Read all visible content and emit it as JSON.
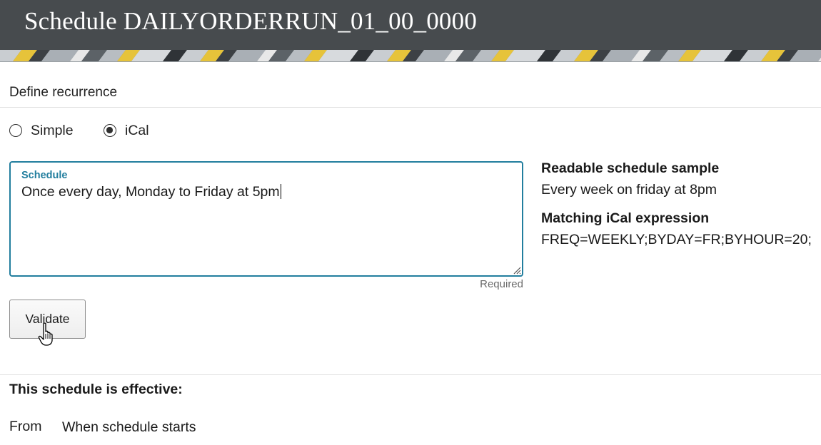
{
  "header": {
    "title": "Schedule DAILYORDERRUN_01_00_0000"
  },
  "recurrence": {
    "section_title": "Define recurrence",
    "options": [
      {
        "label": "Simple",
        "selected": false
      },
      {
        "label": "iCal",
        "selected": true
      }
    ]
  },
  "schedule_field": {
    "label": "Schedule",
    "value": "Once every day, Monday to Friday at 5pm",
    "helper": "Required"
  },
  "validate_button": {
    "label": "Validate"
  },
  "sample": {
    "readable_heading": "Readable schedule sample",
    "readable_value": "Every week on friday at 8pm",
    "ical_heading": "Matching iCal expression",
    "ical_value": "FREQ=WEEKLY;BYDAY=FR;BYHOUR=20;"
  },
  "effective": {
    "title": "This schedule is effective:",
    "from_label": "From",
    "from_value": "When schedule starts"
  },
  "colors": {
    "header_bg": "#474b4e",
    "accent": "#227e9e",
    "banner_yellow": "#e6c33a"
  },
  "icons": {
    "pointer": "hand-pointer-icon",
    "resize": "resize-grip-icon"
  }
}
